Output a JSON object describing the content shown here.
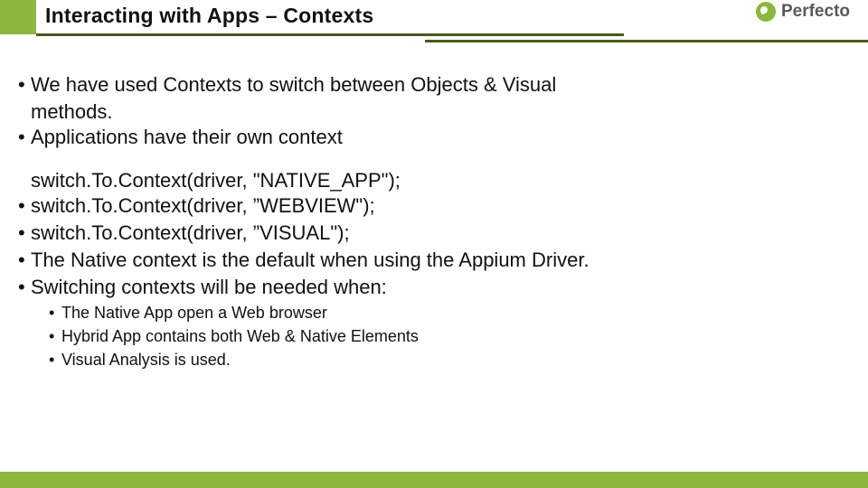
{
  "header": {
    "title": "Interacting with Apps – Contexts",
    "logo_text": "Perfecto"
  },
  "body": {
    "p1a": "We have used Contexts to switch between Objects & Visual",
    "p1b": "methods.",
    "p2": "Applications have their own context",
    "code1": "switch.To.Context(driver, \"NATIVE_APP\");",
    "code2": "switch.To.Context(driver, ”WEBVIEW\");",
    "code3": "switch.To.Context(driver, ”VISUAL\");",
    "p3": "The Native context is the default when using the Appium Driver.",
    "p4": "Switching contexts will be needed when:",
    "s1": "The Native App open a Web browser",
    "s2": "Hybrid App contains both Web & Native Elements",
    "s3": "Visual Analysis is used."
  }
}
